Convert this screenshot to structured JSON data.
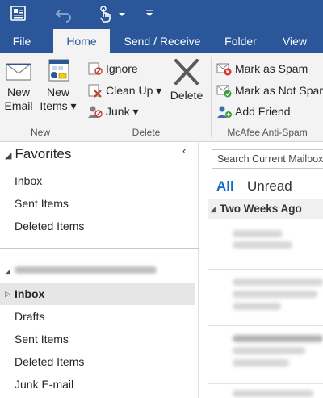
{
  "tabs": [
    "File",
    "Home",
    "Send / Receive",
    "Folder",
    "View"
  ],
  "ribbon": {
    "new_email": [
      "New",
      "Email"
    ],
    "new_items": [
      "New",
      "Items ▾"
    ],
    "ignore": "Ignore",
    "clean_up": "Clean Up ▾",
    "junk": "Junk ▾",
    "delete": "Delete",
    "mark_spam": "Mark as Spam",
    "mark_not_spam": "Mark as Not Spam",
    "add_friend": "Add Friend",
    "groups": {
      "new": "New",
      "delete": "Delete",
      "mcafee": "McAfee Anti-Spam"
    }
  },
  "nav": {
    "favorites_title": "Favorites",
    "favorites": [
      "Inbox",
      "Sent Items",
      "Deleted Items"
    ],
    "account_folders": [
      "Inbox",
      "Drafts",
      "Sent Items",
      "Deleted Items",
      "Junk E-mail"
    ]
  },
  "list": {
    "search_placeholder": "Search Current Mailbox",
    "filter_all": "All",
    "filter_unread": "Unread",
    "group_header": "Two Weeks Ago"
  },
  "colors": {
    "brand": "#2b579a",
    "accent": "#0f6cbd"
  }
}
